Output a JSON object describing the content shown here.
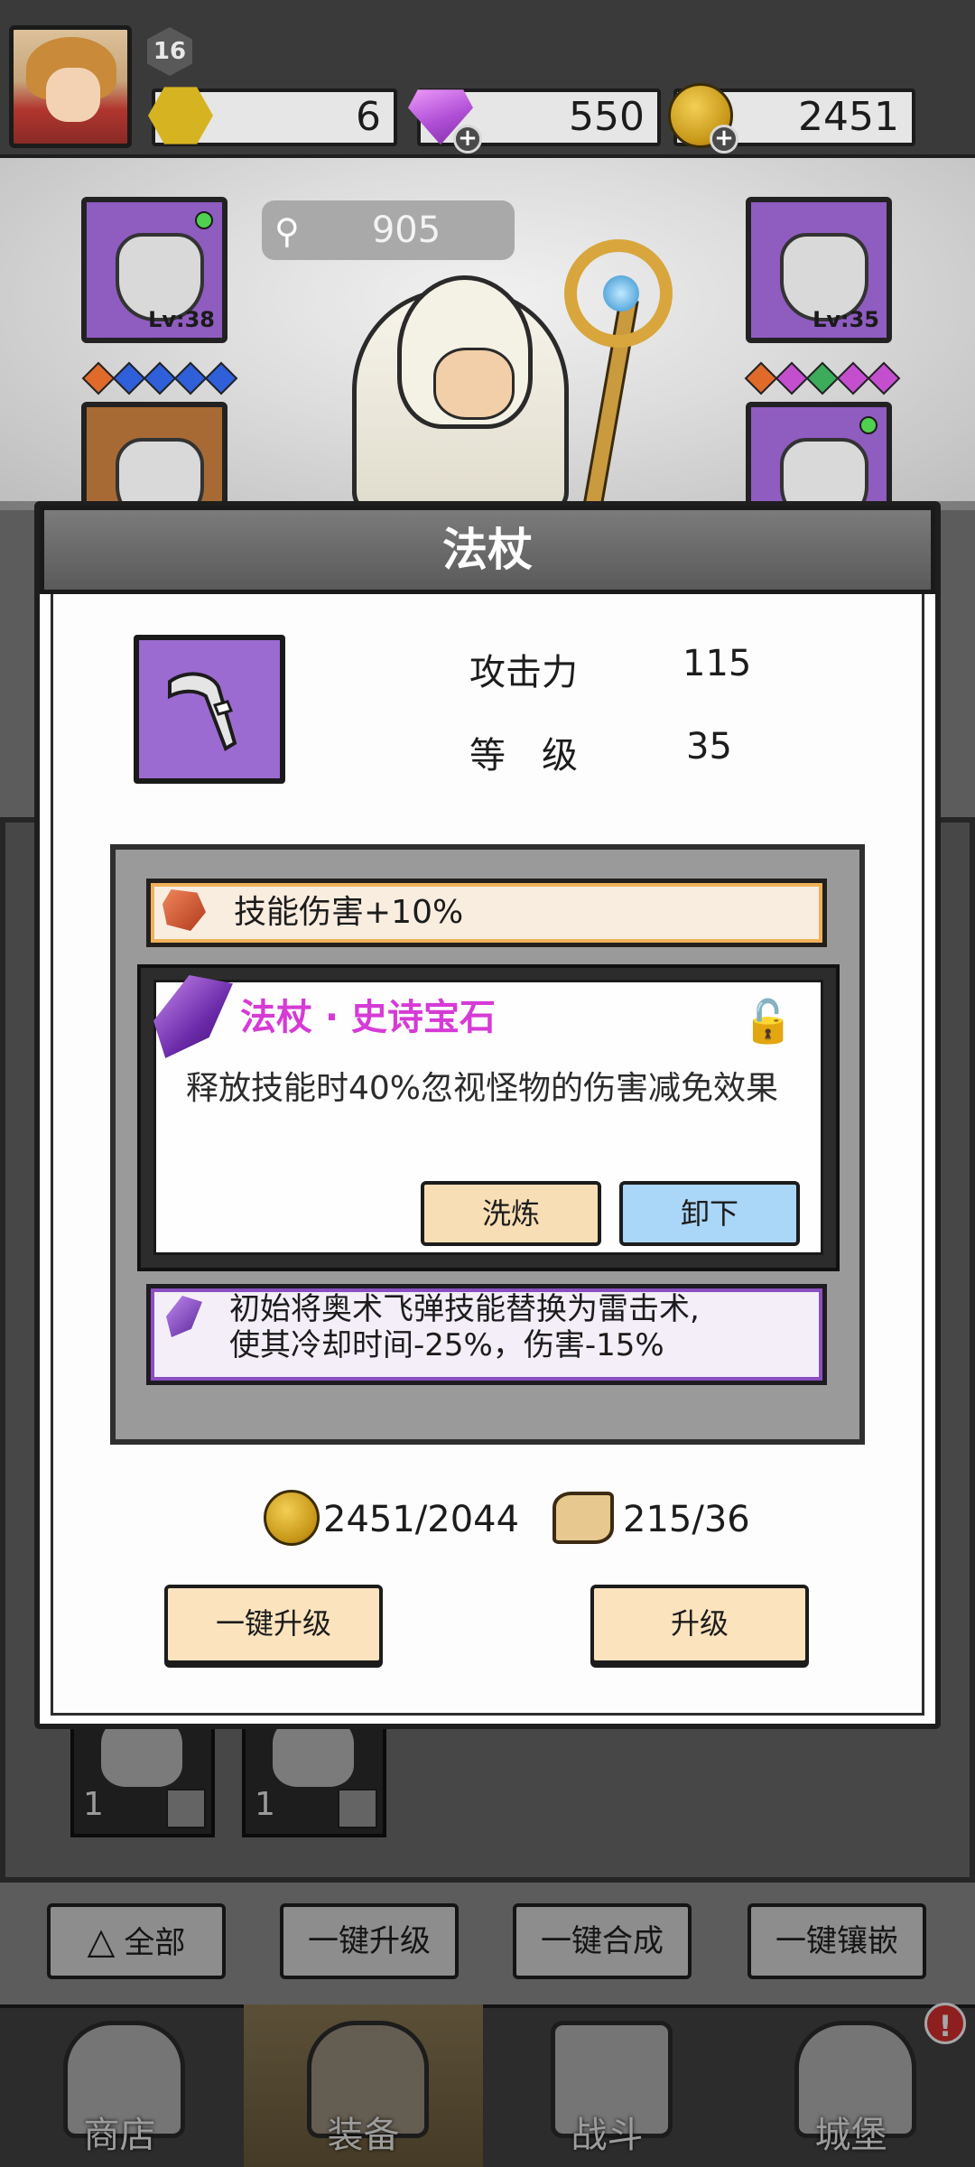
{
  "player": {
    "level": "16"
  },
  "resources": {
    "crystals": "6",
    "diamonds": "550",
    "gold": "2451"
  },
  "stage": {
    "power": "905",
    "left_slot_level": "Lv:38",
    "right_slot_level": "Lv:35"
  },
  "dialog": {
    "title": "法杖",
    "attack_label": "攻击力",
    "attack_value": "115",
    "level_label": "等　级",
    "level_value": "35",
    "skill_bonus": "技能伤害+10%",
    "gem_name": "法杖 · 史诗宝石",
    "gem_description": "释放技能时40%忽视怪物的伤害减免效果",
    "wash_label": "洗炼",
    "unload_label": "卸下",
    "arcane_line1": "初始将奥术飞弹技能替换为雷击术,",
    "arcane_line2": "使其冷却时间-25%，伤害-15%",
    "gold_cost": "2451/2044",
    "scroll_cost": "215/36",
    "one_key_upgrade": "一键升级",
    "upgrade": "升级"
  },
  "inventory": {
    "card1_count": "1",
    "card2_count": "1"
  },
  "actions": {
    "all": "全部",
    "upgrade_all": "一键升级",
    "merge_all": "一键合成",
    "inlay_all": "一键镶嵌"
  },
  "nav": {
    "shop": "商店",
    "equipment": "装备",
    "battle": "战斗",
    "castle": "城堡",
    "alert": "!"
  },
  "colors": {
    "epic_purple": "#9b6bd1",
    "gem_title": "#d63bd6",
    "unload_blue": "#aad6f7",
    "wash_peach": "#f8deb4"
  }
}
